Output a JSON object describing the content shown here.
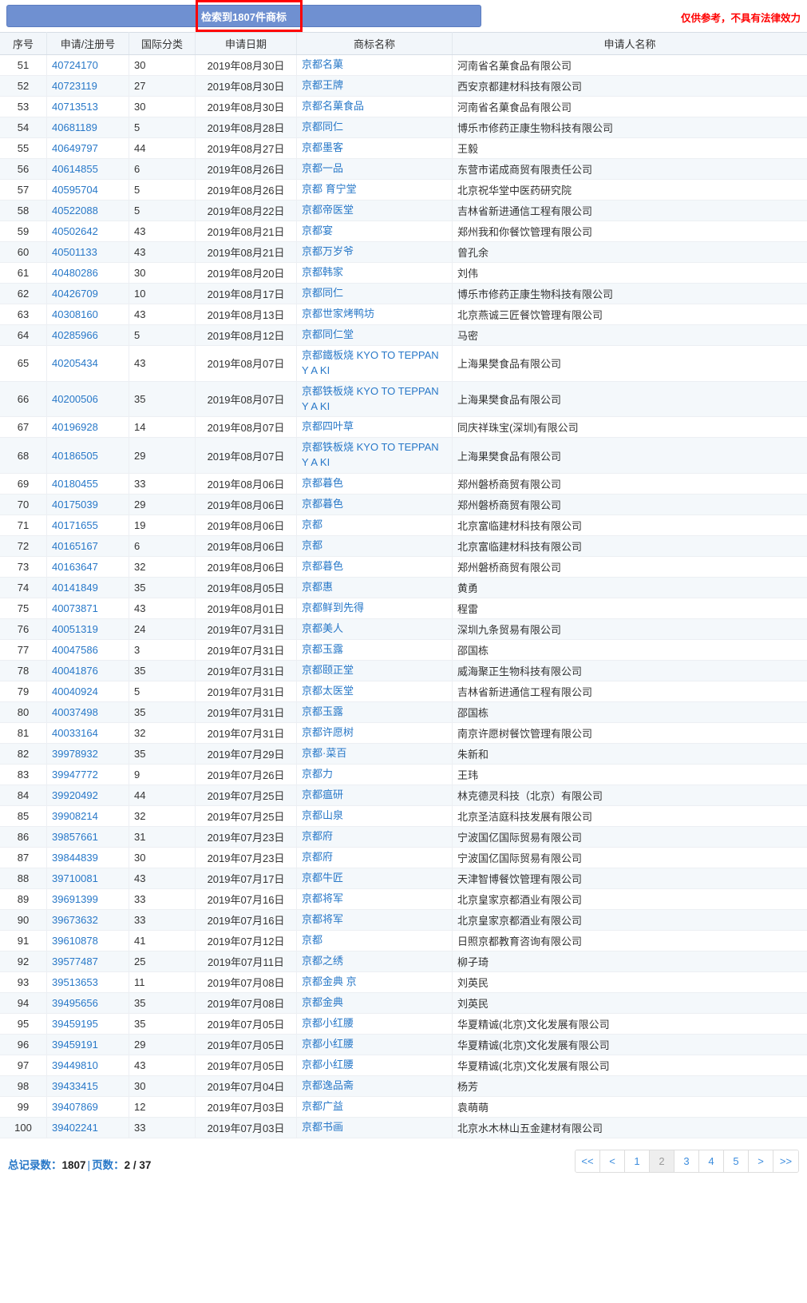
{
  "banner": {
    "text": "检索到1807件商标",
    "highlight_color": "#ff0000",
    "bar_color": "#6f90d1"
  },
  "disclaimer": "仅供参考，不具有法律效力",
  "table": {
    "headers": [
      "序号",
      "申请/注册号",
      "国际分类",
      "申请日期",
      "商标名称",
      "申请人名称"
    ],
    "rows": [
      {
        "idx": "51",
        "regno": "40724170",
        "intl": "30",
        "date": "2019年08月30日",
        "name": "京都名菓",
        "applicant": "河南省名菓食品有限公司"
      },
      {
        "idx": "52",
        "regno": "40723119",
        "intl": "27",
        "date": "2019年08月30日",
        "name": "京都王牌",
        "applicant": "西安京都建材科技有限公司"
      },
      {
        "idx": "53",
        "regno": "40713513",
        "intl": "30",
        "date": "2019年08月30日",
        "name": "京都名菓食品",
        "applicant": "河南省名菓食品有限公司"
      },
      {
        "idx": "54",
        "regno": "40681189",
        "intl": "5",
        "date": "2019年08月28日",
        "name": "京都同仁",
        "applicant": "博乐市修药正康生物科技有限公司"
      },
      {
        "idx": "55",
        "regno": "40649797",
        "intl": "44",
        "date": "2019年08月27日",
        "name": "京都墨客",
        "applicant": "王毅"
      },
      {
        "idx": "56",
        "regno": "40614855",
        "intl": "6",
        "date": "2019年08月26日",
        "name": "京都一品",
        "applicant": "东营市诺成商贸有限责任公司"
      },
      {
        "idx": "57",
        "regno": "40595704",
        "intl": "5",
        "date": "2019年08月26日",
        "name": "京都 育宁堂",
        "applicant": "北京祝华堂中医药研究院"
      },
      {
        "idx": "58",
        "regno": "40522088",
        "intl": "5",
        "date": "2019年08月22日",
        "name": "京都帝医堂",
        "applicant": "吉林省新进通信工程有限公司"
      },
      {
        "idx": "59",
        "regno": "40502642",
        "intl": "43",
        "date": "2019年08月21日",
        "name": "京都宴",
        "applicant": "郑州我和你餐饮管理有限公司"
      },
      {
        "idx": "60",
        "regno": "40501133",
        "intl": "43",
        "date": "2019年08月21日",
        "name": "京都万岁爷",
        "applicant": "曾孔余"
      },
      {
        "idx": "61",
        "regno": "40480286",
        "intl": "30",
        "date": "2019年08月20日",
        "name": "京都韩家",
        "applicant": "刘伟"
      },
      {
        "idx": "62",
        "regno": "40426709",
        "intl": "10",
        "date": "2019年08月17日",
        "name": "京都同仁",
        "applicant": "博乐市修药正康生物科技有限公司"
      },
      {
        "idx": "63",
        "regno": "40308160",
        "intl": "43",
        "date": "2019年08月13日",
        "name": "京都世家烤鸭坊",
        "applicant": "北京燕诚三匠餐饮管理有限公司"
      },
      {
        "idx": "64",
        "regno": "40285966",
        "intl": "5",
        "date": "2019年08月12日",
        "name": "京都同仁堂",
        "applicant": "马密"
      },
      {
        "idx": "65",
        "regno": "40205434",
        "intl": "43",
        "date": "2019年08月07日",
        "name": "京都鐵板烧 KYO TO TEPPAN Y A KI",
        "applicant": "上海果樊食品有限公司"
      },
      {
        "idx": "66",
        "regno": "40200506",
        "intl": "35",
        "date": "2019年08月07日",
        "name": "京都铁板烧 KYO TO TEPPAN Y A KI",
        "applicant": "上海果樊食品有限公司"
      },
      {
        "idx": "67",
        "regno": "40196928",
        "intl": "14",
        "date": "2019年08月07日",
        "name": "京都四叶草",
        "applicant": "同庆祥珠宝(深圳)有限公司"
      },
      {
        "idx": "68",
        "regno": "40186505",
        "intl": "29",
        "date": "2019年08月07日",
        "name": "京都铁板烧 KYO TO TEPPAN Y A KI",
        "applicant": "上海果樊食品有限公司"
      },
      {
        "idx": "69",
        "regno": "40180455",
        "intl": "33",
        "date": "2019年08月06日",
        "name": "京都暮色",
        "applicant": "郑州磐桥商贸有限公司"
      },
      {
        "idx": "70",
        "regno": "40175039",
        "intl": "29",
        "date": "2019年08月06日",
        "name": "京都暮色",
        "applicant": "郑州磐桥商贸有限公司"
      },
      {
        "idx": "71",
        "regno": "40171655",
        "intl": "19",
        "date": "2019年08月06日",
        "name": "京都",
        "applicant": "北京富临建材科技有限公司"
      },
      {
        "idx": "72",
        "regno": "40165167",
        "intl": "6",
        "date": "2019年08月06日",
        "name": "京都",
        "applicant": "北京富临建材科技有限公司"
      },
      {
        "idx": "73",
        "regno": "40163647",
        "intl": "32",
        "date": "2019年08月06日",
        "name": "京都暮色",
        "applicant": "郑州磐桥商贸有限公司"
      },
      {
        "idx": "74",
        "regno": "40141849",
        "intl": "35",
        "date": "2019年08月05日",
        "name": "京都惠",
        "applicant": "黄勇"
      },
      {
        "idx": "75",
        "regno": "40073871",
        "intl": "43",
        "date": "2019年08月01日",
        "name": "京都鲜到先得",
        "applicant": "程雷"
      },
      {
        "idx": "76",
        "regno": "40051319",
        "intl": "24",
        "date": "2019年07月31日",
        "name": "京都美人",
        "applicant": "深圳九条贸易有限公司"
      },
      {
        "idx": "77",
        "regno": "40047586",
        "intl": "3",
        "date": "2019年07月31日",
        "name": "京都玉露",
        "applicant": "邵国栋"
      },
      {
        "idx": "78",
        "regno": "40041876",
        "intl": "35",
        "date": "2019年07月31日",
        "name": "京都颐正堂",
        "applicant": "威海聚正生物科技有限公司"
      },
      {
        "idx": "79",
        "regno": "40040924",
        "intl": "5",
        "date": "2019年07月31日",
        "name": "京都太医堂",
        "applicant": "吉林省新进通信工程有限公司"
      },
      {
        "idx": "80",
        "regno": "40037498",
        "intl": "35",
        "date": "2019年07月31日",
        "name": "京都玉露",
        "applicant": "邵国栋"
      },
      {
        "idx": "81",
        "regno": "40033164",
        "intl": "32",
        "date": "2019年07月31日",
        "name": "京都许愿树",
        "applicant": "南京许愿树餐饮管理有限公司"
      },
      {
        "idx": "82",
        "regno": "39978932",
        "intl": "35",
        "date": "2019年07月29日",
        "name": "京都·菜百",
        "applicant": "朱新和"
      },
      {
        "idx": "83",
        "regno": "39947772",
        "intl": "9",
        "date": "2019年07月26日",
        "name": "京都力",
        "applicant": "王玮"
      },
      {
        "idx": "84",
        "regno": "39920492",
        "intl": "44",
        "date": "2019年07月25日",
        "name": "京都瘟研",
        "applicant": "林克德灵科技（北京）有限公司"
      },
      {
        "idx": "85",
        "regno": "39908214",
        "intl": "32",
        "date": "2019年07月25日",
        "name": "京都山泉",
        "applicant": "北京圣洁庭科技发展有限公司"
      },
      {
        "idx": "86",
        "regno": "39857661",
        "intl": "31",
        "date": "2019年07月23日",
        "name": "京都府",
        "applicant": "宁波国亿国际贸易有限公司"
      },
      {
        "idx": "87",
        "regno": "39844839",
        "intl": "30",
        "date": "2019年07月23日",
        "name": "京都府",
        "applicant": "宁波国亿国际贸易有限公司"
      },
      {
        "idx": "88",
        "regno": "39710081",
        "intl": "43",
        "date": "2019年07月17日",
        "name": "京都牛匠",
        "applicant": "天津智博餐饮管理有限公司"
      },
      {
        "idx": "89",
        "regno": "39691399",
        "intl": "33",
        "date": "2019年07月16日",
        "name": "京都将军",
        "applicant": "北京皇家京都酒业有限公司"
      },
      {
        "idx": "90",
        "regno": "39673632",
        "intl": "33",
        "date": "2019年07月16日",
        "name": "京都将军",
        "applicant": "北京皇家京都酒业有限公司"
      },
      {
        "idx": "91",
        "regno": "39610878",
        "intl": "41",
        "date": "2019年07月12日",
        "name": "京都",
        "applicant": "日照京都教育咨询有限公司"
      },
      {
        "idx": "92",
        "regno": "39577487",
        "intl": "25",
        "date": "2019年07月11日",
        "name": "京都之绣",
        "applicant": "柳子琦"
      },
      {
        "idx": "93",
        "regno": "39513653",
        "intl": "11",
        "date": "2019年07月08日",
        "name": "京都金典 京",
        "applicant": "刘英民"
      },
      {
        "idx": "94",
        "regno": "39495656",
        "intl": "35",
        "date": "2019年07月08日",
        "name": "京都金典",
        "applicant": "刘英民"
      },
      {
        "idx": "95",
        "regno": "39459195",
        "intl": "35",
        "date": "2019年07月05日",
        "name": "京都小红腰",
        "applicant": "华夏精诚(北京)文化发展有限公司"
      },
      {
        "idx": "96",
        "regno": "39459191",
        "intl": "29",
        "date": "2019年07月05日",
        "name": "京都小红腰",
        "applicant": "华夏精诚(北京)文化发展有限公司"
      },
      {
        "idx": "97",
        "regno": "39449810",
        "intl": "43",
        "date": "2019年07月05日",
        "name": "京都小红腰",
        "applicant": "华夏精诚(北京)文化发展有限公司"
      },
      {
        "idx": "98",
        "regno": "39433415",
        "intl": "30",
        "date": "2019年07月04日",
        "name": "京都逸品斋",
        "applicant": "杨芳"
      },
      {
        "idx": "99",
        "regno": "39407869",
        "intl": "12",
        "date": "2019年07月03日",
        "name": "京都广益",
        "applicant": "袁萌萌"
      },
      {
        "idx": "100",
        "regno": "39402241",
        "intl": "33",
        "date": "2019年07月03日",
        "name": "京都书画",
        "applicant": "北京水木林山五金建材有限公司"
      }
    ]
  },
  "footer": {
    "total_label": "总记录数",
    "total_value": "1807",
    "page_label": "页数",
    "page_value": "2 / 37",
    "separator": "|",
    "colon": "：",
    "pager": [
      {
        "label": "<<",
        "name": "first",
        "current": false
      },
      {
        "label": "<",
        "name": "prev",
        "current": false
      },
      {
        "label": "1",
        "name": "page-1",
        "current": false
      },
      {
        "label": "2",
        "name": "page-2",
        "current": true
      },
      {
        "label": "3",
        "name": "page-3",
        "current": false
      },
      {
        "label": "4",
        "name": "page-4",
        "current": false
      },
      {
        "label": "5",
        "name": "page-5",
        "current": false
      },
      {
        "label": ">",
        "name": "next",
        "current": false
      },
      {
        "label": ">>",
        "name": "last",
        "current": false
      }
    ]
  }
}
